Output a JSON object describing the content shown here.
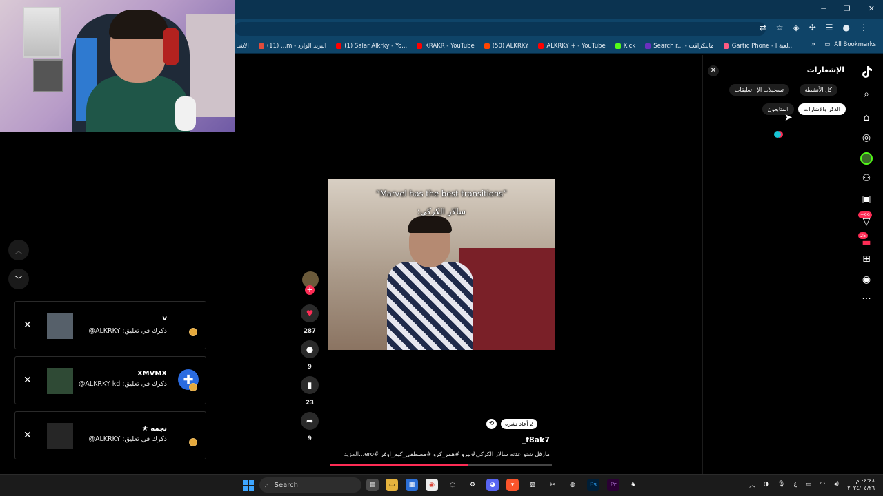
{
  "window": {
    "controls": [
      "─",
      "❐",
      "✕"
    ]
  },
  "bookmarks": [
    {
      "label": "الاشـ",
      "color": "#888"
    },
    {
      "label": "(11) ...m - البريد الوارد",
      "color": "#e14c3c"
    },
    {
      "label": "(1) Salar Alkrky - Yo...",
      "color": "#ff0000"
    },
    {
      "label": "KRAKR - YouTube",
      "color": "#ff0000"
    },
    {
      "label": "(50) ALKRKY",
      "color": "#ff4500"
    },
    {
      "label": "ALKRKY + - YouTube",
      "color": "#ff0000"
    },
    {
      "label": "Kick",
      "color": "#53fc18"
    },
    {
      "label": "Search r... - ماينكرافت",
      "color": "#6b2fbf"
    },
    {
      "label": "Gartic Phone - لعبة ا...",
      "color": "#ff5a82"
    }
  ],
  "all_bookmarks": "All Bookmarks",
  "nav": {
    "up_icon": "chevron-up-icon",
    "down_icon": "chevron-down-icon"
  },
  "notifications": [
    {
      "title": "v",
      "subtitle": "ذكرك في تعليق: ALKRKY@"
    },
    {
      "title": "XMVMX",
      "subtitle": "ذكرك في تعليق: ALKRKY kd@"
    },
    {
      "title": "نجمه ★",
      "subtitle": "ذكرك في تعليق: ALKRKY@"
    }
  ],
  "video": {
    "caption_top": "“Marvel has the best transitions”",
    "caption_bottom": "سالار الكركي:",
    "reposts": "2 أعاد نشره",
    "author": "_f8ak7",
    "description": "مارفل شنو عدنه سالار الكركي#بيرو #همر_كرو #مصطفى_كيم_اوفر #ero...",
    "more": "المزيد",
    "progress": 0.62
  },
  "actions": {
    "likes": "287",
    "comments": "9",
    "saves": "23",
    "shares": "9"
  },
  "panel": {
    "title": "الإشعارات",
    "tabs": [
      "كل الأنشطة",
      "تسجيلات الإعجاب",
      "تعليقات",
      "الذكر والإشارات",
      "المتابعون"
    ],
    "active_tab": "الذكر والإشارات"
  },
  "sidebar_badges": {
    "messages": "+99",
    "inbox": "25"
  },
  "taskbar": {
    "search": "Search",
    "clock_time": "٠٤:٤٨ م",
    "clock_date": "٢٠٢٤/٠٤/٢٦",
    "lang": "ع"
  },
  "colors": {
    "accent": "#fe2c55",
    "chrome": "#0f4468"
  }
}
